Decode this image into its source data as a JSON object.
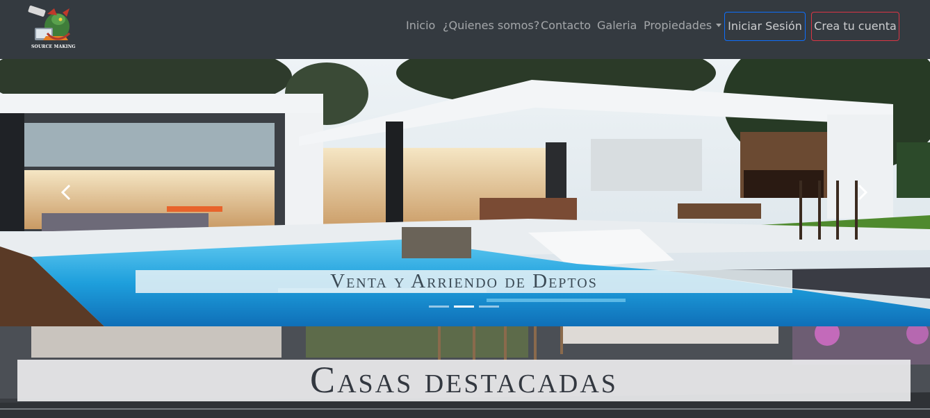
{
  "logo": {
    "text": "SOURCE MAKING",
    "icon": "dragon-laptop-logo-icon"
  },
  "nav": {
    "links": [
      "Inicio",
      "¿Quienes somos?",
      "Contacto",
      "Galeria",
      "Propiedades"
    ],
    "dropdown_icon": "caret-down-icon",
    "login_button": "Iniciar Sesión",
    "signup_button": "Crea tu cuenta"
  },
  "carousel": {
    "caption": "Venta y Arriendo de Deptos",
    "slide_count": 3,
    "active_slide": 2,
    "prev_icon": "chevron-left-icon",
    "next_icon": "chevron-right-icon"
  },
  "featured": {
    "title": "Casas destacadas"
  },
  "colors": {
    "navbar": "#343a40",
    "login_border": "#0d6efd",
    "signup_border": "#dc3545"
  }
}
